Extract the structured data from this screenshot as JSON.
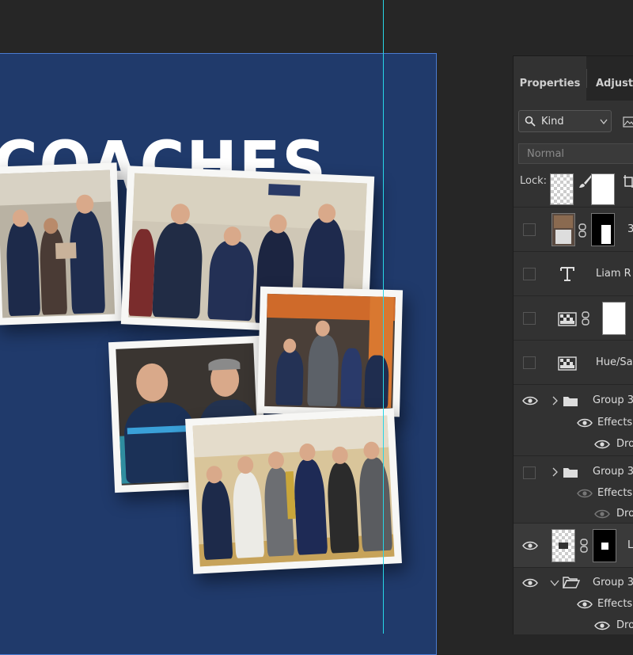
{
  "canvas": {
    "title": "COACHES",
    "background": "#203a6b",
    "guide_color": "#27d6e6"
  },
  "panel": {
    "tabs": [
      "Properties",
      "Adjustm"
    ],
    "filter": {
      "kind_label": "Kind"
    },
    "blend_mode": "Normal",
    "lock_label": "Lock:",
    "layers": [
      {
        "name": "3",
        "type": "smart-mask",
        "visible": false
      },
      {
        "name": "Liam  R",
        "type": "text",
        "visible": false
      },
      {
        "name": "",
        "type": "adjustment-mask",
        "visible": false
      },
      {
        "name": "Hue/Sat",
        "type": "adjustment",
        "visible": false
      },
      {
        "name": "Group 3",
        "type": "group",
        "visible": true
      },
      {
        "name": "Effects",
        "type": "effects",
        "visible": true
      },
      {
        "name": "Dro",
        "type": "effect",
        "visible": true
      },
      {
        "name": "Group 3",
        "type": "group",
        "visible": false
      },
      {
        "name": "Effects",
        "type": "effects",
        "visible": false
      },
      {
        "name": "Drop",
        "type": "effect",
        "visible": false
      },
      {
        "name": "L",
        "type": "smart-mask",
        "visible": true
      },
      {
        "name": "Group 3",
        "type": "group",
        "visible": true
      },
      {
        "name": "Effects",
        "type": "effects",
        "visible": true
      },
      {
        "name": "Dro",
        "type": "effect",
        "visible": true
      }
    ]
  },
  "photos": [
    {
      "name": "coaches-group-photo"
    },
    {
      "name": "bleachers-coaches-photo"
    },
    {
      "name": "two-coaches-smiling-photo"
    },
    {
      "name": "cheering-coach-photo"
    },
    {
      "name": "trophy-team-photo"
    }
  ]
}
